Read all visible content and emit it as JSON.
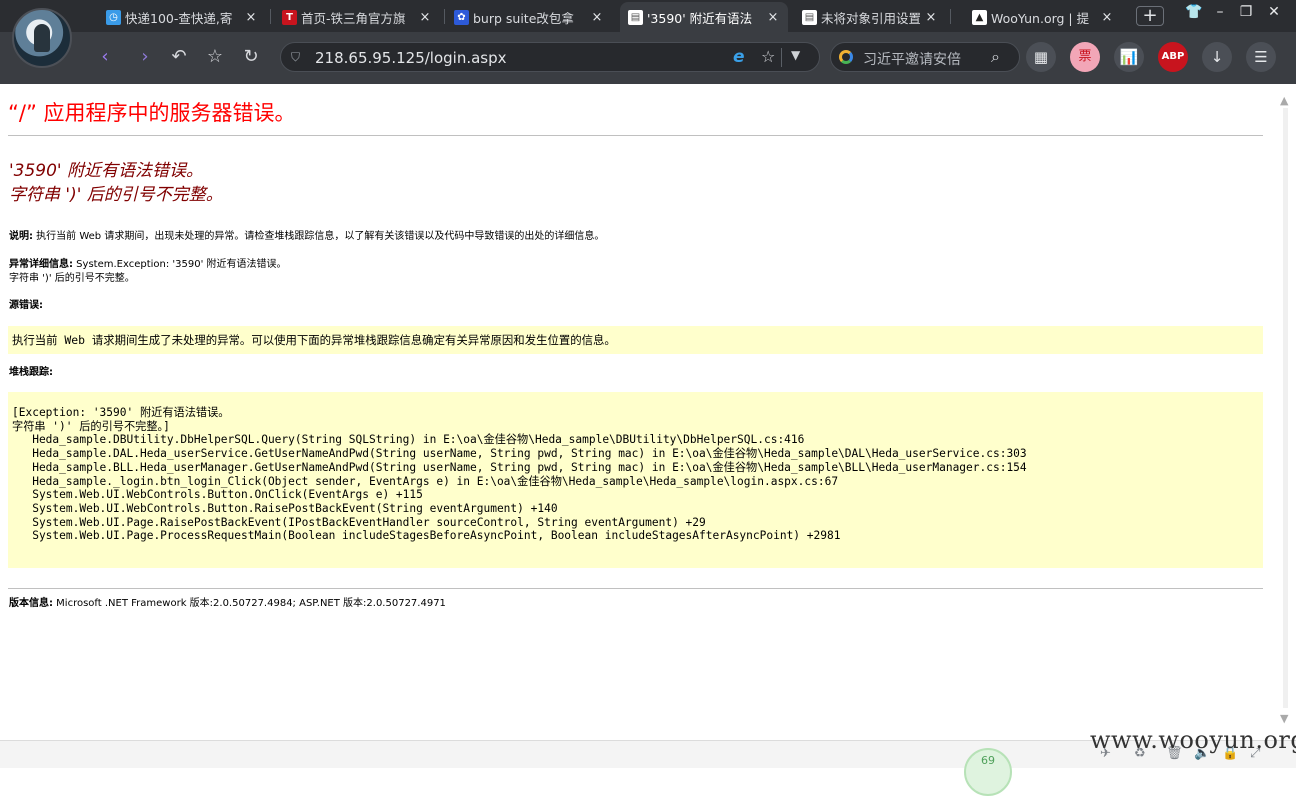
{
  "browser": {
    "tabs": [
      {
        "title": "快递100-查快递,寄",
        "icon": "clock-icon",
        "color": "#3a9be8",
        "active": false
      },
      {
        "title": "首页-铁三角官方旗",
        "icon": "T",
        "color": "#c8141e",
        "active": false
      },
      {
        "title": "burp suite改包拿",
        "icon": "paw-icon",
        "color": "#2d5ad8",
        "active": false
      },
      {
        "title": "'3590' 附近有语法",
        "icon": "doc-icon",
        "color": "#ffffff",
        "active": true
      },
      {
        "title": "未将对象引用设置",
        "icon": "doc-icon",
        "color": "#ffffff",
        "active": false
      },
      {
        "title": "WooYun.org | 提",
        "icon": "triangle-icon",
        "color": "#ffffff",
        "active": false
      }
    ],
    "close_glyph": "×",
    "new_tab_glyph": "+",
    "url": "218.65.95.125/login.aspx",
    "search_placeholder": "习近平邀请安倍",
    "ie_glyph": "e",
    "toolbar": {
      "abp": "ABP",
      "pink": "票"
    }
  },
  "page": {
    "heading": "“/” 应用程序中的服务器错误。",
    "error_line1": "'3590' 附近有语法错误。",
    "error_line2": "字符串 ')' 后的引号不完整。",
    "desc_label": "说明:",
    "desc_text": " 执行当前 Web 请求期间，出现未处理的异常。请检查堆栈跟踪信息，以了解有关该错误以及代码中导致错误的出处的详细信息。",
    "exc_label": "异常详细信息:",
    "exc_text1": " System.Exception: '3590' 附近有语法错误。",
    "exc_text2": "字符串 ')' 后的引号不完整。",
    "source_label": "源错误:",
    "source_text": "执行当前 Web 请求期间生成了未处理的异常。可以使用下面的异常堆栈跟踪信息确定有关异常原因和发生位置的信息。",
    "stack_label": "堆栈跟踪:",
    "stack_trace": [
      "[Exception: '3590' 附近有语法错误。",
      "字符串 ')' 后的引号不完整。]",
      "   Heda_sample.DBUtility.DbHelperSQL.Query(String SQLString) in E:\\oa\\金佳谷物\\Heda_sample\\DBUtility\\DbHelperSQL.cs:416",
      "   Heda_sample.DAL.Heda_userService.GetUserNameAndPwd(String userName, String pwd, String mac) in E:\\oa\\金佳谷物\\Heda_sample\\DAL\\Heda_userService.cs:303",
      "   Heda_sample.BLL.Heda_userManager.GetUserNameAndPwd(String userName, String pwd, String mac) in E:\\oa\\金佳谷物\\Heda_sample\\BLL\\Heda_userManager.cs:154",
      "   Heda_sample._login.btn_login_Click(Object sender, EventArgs e) in E:\\oa\\金佳谷物\\Heda_sample\\Heda_sample\\login.aspx.cs:67",
      "   System.Web.UI.WebControls.Button.OnClick(EventArgs e) +115",
      "   System.Web.UI.WebControls.Button.RaisePostBackEvent(String eventArgument) +140",
      "   System.Web.UI.Page.RaisePostBackEvent(IPostBackEventHandler sourceControl, String eventArgument) +29",
      "   System.Web.UI.Page.ProcessRequestMain(Boolean includeStagesBeforeAsyncPoint, Boolean includeStagesAfterAsyncPoint) +2981"
    ],
    "version_label": "版本信息:",
    "version_text": " Microsoft .NET Framework 版本:2.0.50727.4984; ASP.NET 版本:2.0.50727.4971"
  },
  "statusbar": {
    "circle_value": "69",
    "watermark": "www.wooyun.org"
  }
}
